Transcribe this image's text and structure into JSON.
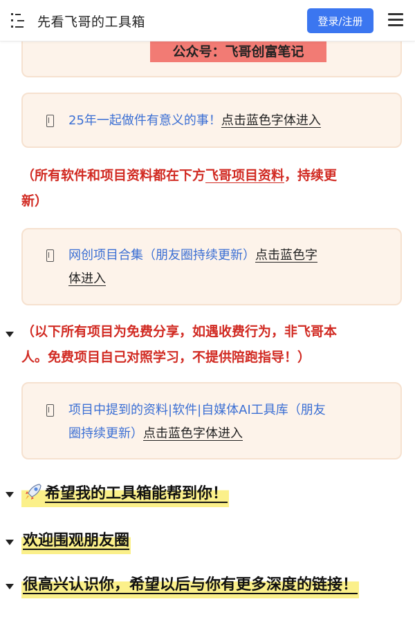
{
  "header": {
    "title": "先看飞哥的工具箱",
    "login_label": "登录/注册"
  },
  "content": {
    "banner_text": "公众号：飞哥创富笔记",
    "callout1": {
      "blue_text": "25年一起做件有意义的事！",
      "link_text": "点击蓝色字体进入"
    },
    "note1": {
      "before": "（所有软件和项目资料都在下方",
      "link": "飞哥项目资料",
      "after_line1": "，持续更",
      "line2": "新）"
    },
    "callout2": {
      "blue_line1": "网创项目合集（朋友圈持续更新）",
      "link_line1": "点击蓝色字",
      "link_line2": "体进入"
    },
    "note2": {
      "line1": "（以下所有项目为免费分享，如遇收费行为，非飞哥本",
      "line2": "人。免费项目自己对照学习，不提供陪跑指导！）"
    },
    "callout3": {
      "blue_line1": "项目中提到的资料|软件|自媒体AI工具库（朋友",
      "blue_line2": "圈持续更新）",
      "link_line2": "点击蓝色字体进入"
    },
    "headings": [
      "希望我的工具箱能帮到你！",
      "欢迎围观朋友圈",
      "很高兴认识你，希望以后与你有更多深度的链接！"
    ]
  },
  "colors": {
    "accent_blue": "#3b76f0",
    "link_blue": "#3b6fd4",
    "note_red": "#d12a22",
    "callout_bg": "#fdf3ea",
    "banner_red": "#f27b74",
    "highlight_yellow": "#fbf08a"
  },
  "icons": [
    "toc-icon",
    "menu-icon",
    "bookmark-icon",
    "rocket-icon",
    "caret-down-icon"
  ]
}
